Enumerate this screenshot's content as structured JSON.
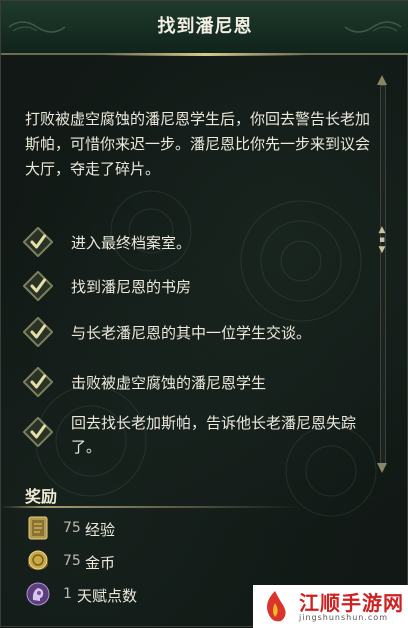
{
  "quest": {
    "title": "找到潘尼恩",
    "description": "打败被虚空腐蚀的潘尼恩学生后，你回去警告长老加斯帕，可惜你来迟一步。潘尼恩比你先一步来到议会大厅，夺走了碎片。",
    "objectives": [
      {
        "text": "进入最终档案室。",
        "completed": true
      },
      {
        "text": "找到潘尼恩的书房",
        "completed": true
      },
      {
        "text": "与长老潘尼恩的其中一位学生交谈。",
        "completed": true
      },
      {
        "text": "击败被虚空腐蚀的潘尼恩学生",
        "completed": true
      },
      {
        "text": "回去找长老加斯帕，告诉他长老潘尼恩失踪了。",
        "completed": true
      }
    ]
  },
  "rewards": {
    "title": "奖励",
    "items": [
      {
        "icon": "xp-book-icon",
        "value": "75",
        "label": "经验"
      },
      {
        "icon": "gold-coin-icon",
        "value": "75",
        "label": "金币"
      },
      {
        "icon": "talent-point-icon",
        "value": "1",
        "label": "天赋点数"
      }
    ]
  },
  "watermark": {
    "name": "江顺手游网",
    "url": "jingshunshun.com"
  },
  "colors": {
    "header_bg": "#1f3a2d",
    "check_frame": "#6f7552",
    "check_mark": "#e6e0a8",
    "text": "#ece9dc"
  }
}
